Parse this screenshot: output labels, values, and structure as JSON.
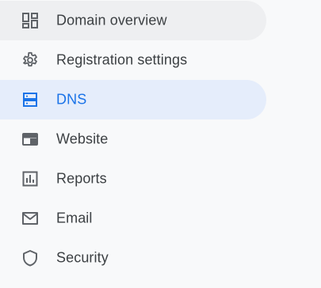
{
  "sidebar": {
    "accent_color": "#1a73e8",
    "items": [
      {
        "label": "Domain overview",
        "icon": "dashboard-icon",
        "state": "hover"
      },
      {
        "label": "Registration settings",
        "icon": "gear-icon",
        "state": "normal"
      },
      {
        "label": "DNS",
        "icon": "dns-server-icon",
        "state": "active"
      },
      {
        "label": "Website",
        "icon": "web-browser-icon",
        "state": "normal"
      },
      {
        "label": "Reports",
        "icon": "bar-chart-icon",
        "state": "normal"
      },
      {
        "label": "Email",
        "icon": "envelope-icon",
        "state": "normal"
      },
      {
        "label": "Security",
        "icon": "shield-icon",
        "state": "normal"
      }
    ]
  }
}
